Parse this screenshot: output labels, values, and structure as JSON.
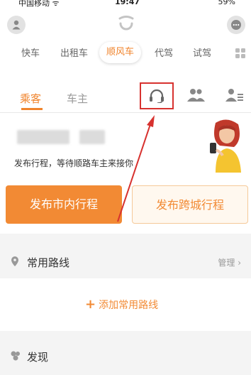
{
  "status_bar": {
    "carrier": "中国移动 ᯤ",
    "time": "19:47",
    "battery": "59%"
  },
  "categories": [
    {
      "label": "快车",
      "active": false
    },
    {
      "label": "出租车",
      "active": false
    },
    {
      "label": "顺风车",
      "active": true
    },
    {
      "label": "代驾",
      "active": false
    },
    {
      "label": "试驾",
      "active": false
    }
  ],
  "roles": {
    "passenger": "乘客",
    "driver": "车主"
  },
  "main": {
    "hint": "发布行程，等待顺路车主来接你",
    "button_city": "发布市内行程",
    "button_intercity": "发布跨城行程"
  },
  "routes": {
    "title": "常用路线",
    "manage": "管理",
    "add": "添加常用路线"
  },
  "discover": {
    "title": "发现"
  },
  "colors": {
    "accent": "#f0842d",
    "highlight_box": "#d7322f"
  },
  "icons": [
    "user-avatar-icon",
    "didi-logo-icon",
    "message-icon",
    "grid-icon",
    "headset-icon",
    "people-icon",
    "person-list-icon",
    "location-pin-icon",
    "discover-icon"
  ]
}
